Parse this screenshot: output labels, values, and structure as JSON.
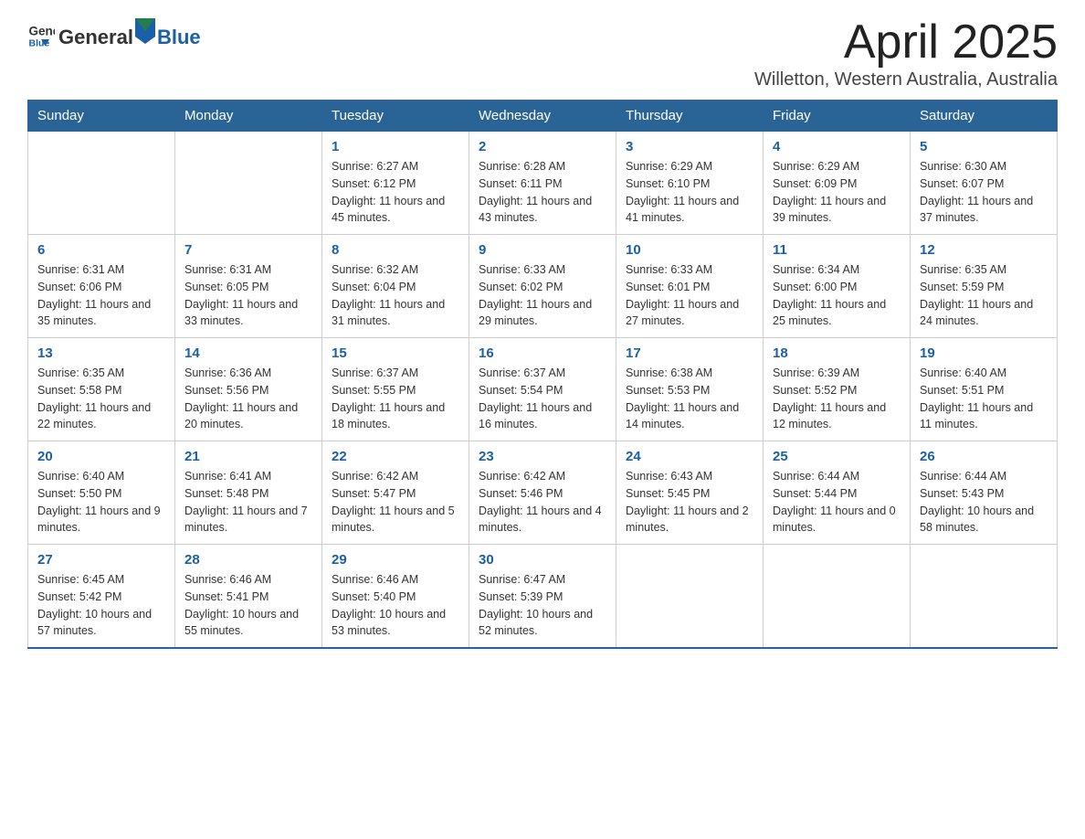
{
  "header": {
    "logo": {
      "text_general": "General",
      "text_blue": "Blue"
    },
    "title": "April 2025",
    "location": "Willetton, Western Australia, Australia"
  },
  "days_of_week": [
    "Sunday",
    "Monday",
    "Tuesday",
    "Wednesday",
    "Thursday",
    "Friday",
    "Saturday"
  ],
  "weeks": [
    [
      {
        "day": "",
        "info": ""
      },
      {
        "day": "",
        "info": ""
      },
      {
        "day": "1",
        "info": "Sunrise: 6:27 AM\nSunset: 6:12 PM\nDaylight: 11 hours\nand 45 minutes."
      },
      {
        "day": "2",
        "info": "Sunrise: 6:28 AM\nSunset: 6:11 PM\nDaylight: 11 hours\nand 43 minutes."
      },
      {
        "day": "3",
        "info": "Sunrise: 6:29 AM\nSunset: 6:10 PM\nDaylight: 11 hours\nand 41 minutes."
      },
      {
        "day": "4",
        "info": "Sunrise: 6:29 AM\nSunset: 6:09 PM\nDaylight: 11 hours\nand 39 minutes."
      },
      {
        "day": "5",
        "info": "Sunrise: 6:30 AM\nSunset: 6:07 PM\nDaylight: 11 hours\nand 37 minutes."
      }
    ],
    [
      {
        "day": "6",
        "info": "Sunrise: 6:31 AM\nSunset: 6:06 PM\nDaylight: 11 hours\nand 35 minutes."
      },
      {
        "day": "7",
        "info": "Sunrise: 6:31 AM\nSunset: 6:05 PM\nDaylight: 11 hours\nand 33 minutes."
      },
      {
        "day": "8",
        "info": "Sunrise: 6:32 AM\nSunset: 6:04 PM\nDaylight: 11 hours\nand 31 minutes."
      },
      {
        "day": "9",
        "info": "Sunrise: 6:33 AM\nSunset: 6:02 PM\nDaylight: 11 hours\nand 29 minutes."
      },
      {
        "day": "10",
        "info": "Sunrise: 6:33 AM\nSunset: 6:01 PM\nDaylight: 11 hours\nand 27 minutes."
      },
      {
        "day": "11",
        "info": "Sunrise: 6:34 AM\nSunset: 6:00 PM\nDaylight: 11 hours\nand 25 minutes."
      },
      {
        "day": "12",
        "info": "Sunrise: 6:35 AM\nSunset: 5:59 PM\nDaylight: 11 hours\nand 24 minutes."
      }
    ],
    [
      {
        "day": "13",
        "info": "Sunrise: 6:35 AM\nSunset: 5:58 PM\nDaylight: 11 hours\nand 22 minutes."
      },
      {
        "day": "14",
        "info": "Sunrise: 6:36 AM\nSunset: 5:56 PM\nDaylight: 11 hours\nand 20 minutes."
      },
      {
        "day": "15",
        "info": "Sunrise: 6:37 AM\nSunset: 5:55 PM\nDaylight: 11 hours\nand 18 minutes."
      },
      {
        "day": "16",
        "info": "Sunrise: 6:37 AM\nSunset: 5:54 PM\nDaylight: 11 hours\nand 16 minutes."
      },
      {
        "day": "17",
        "info": "Sunrise: 6:38 AM\nSunset: 5:53 PM\nDaylight: 11 hours\nand 14 minutes."
      },
      {
        "day": "18",
        "info": "Sunrise: 6:39 AM\nSunset: 5:52 PM\nDaylight: 11 hours\nand 12 minutes."
      },
      {
        "day": "19",
        "info": "Sunrise: 6:40 AM\nSunset: 5:51 PM\nDaylight: 11 hours\nand 11 minutes."
      }
    ],
    [
      {
        "day": "20",
        "info": "Sunrise: 6:40 AM\nSunset: 5:50 PM\nDaylight: 11 hours\nand 9 minutes."
      },
      {
        "day": "21",
        "info": "Sunrise: 6:41 AM\nSunset: 5:48 PM\nDaylight: 11 hours\nand 7 minutes."
      },
      {
        "day": "22",
        "info": "Sunrise: 6:42 AM\nSunset: 5:47 PM\nDaylight: 11 hours\nand 5 minutes."
      },
      {
        "day": "23",
        "info": "Sunrise: 6:42 AM\nSunset: 5:46 PM\nDaylight: 11 hours\nand 4 minutes."
      },
      {
        "day": "24",
        "info": "Sunrise: 6:43 AM\nSunset: 5:45 PM\nDaylight: 11 hours\nand 2 minutes."
      },
      {
        "day": "25",
        "info": "Sunrise: 6:44 AM\nSunset: 5:44 PM\nDaylight: 11 hours\nand 0 minutes."
      },
      {
        "day": "26",
        "info": "Sunrise: 6:44 AM\nSunset: 5:43 PM\nDaylight: 10 hours\nand 58 minutes."
      }
    ],
    [
      {
        "day": "27",
        "info": "Sunrise: 6:45 AM\nSunset: 5:42 PM\nDaylight: 10 hours\nand 57 minutes."
      },
      {
        "day": "28",
        "info": "Sunrise: 6:46 AM\nSunset: 5:41 PM\nDaylight: 10 hours\nand 55 minutes."
      },
      {
        "day": "29",
        "info": "Sunrise: 6:46 AM\nSunset: 5:40 PM\nDaylight: 10 hours\nand 53 minutes."
      },
      {
        "day": "30",
        "info": "Sunrise: 6:47 AM\nSunset: 5:39 PM\nDaylight: 10 hours\nand 52 minutes."
      },
      {
        "day": "",
        "info": ""
      },
      {
        "day": "",
        "info": ""
      },
      {
        "day": "",
        "info": ""
      }
    ]
  ]
}
